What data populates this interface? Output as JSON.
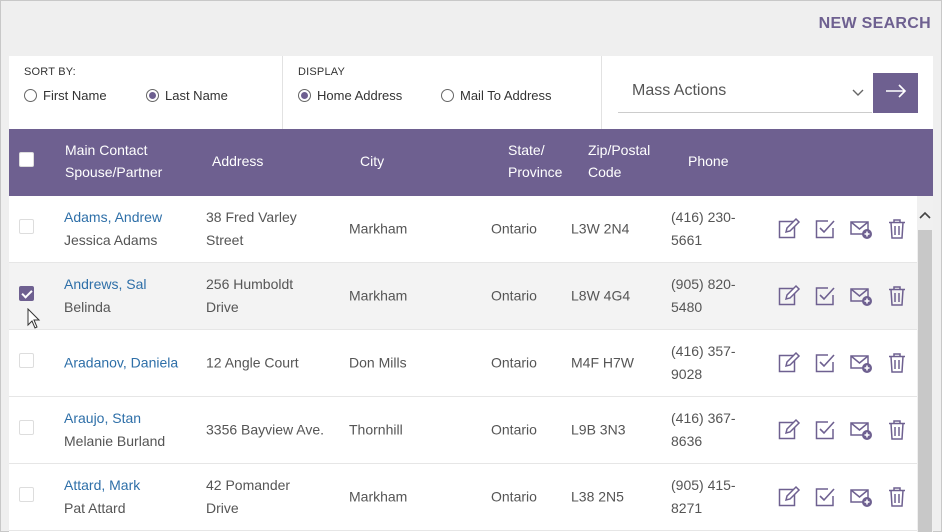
{
  "header": {
    "new_search": "NEW SEARCH"
  },
  "sort": {
    "label": "SORT BY:",
    "options": [
      {
        "label": "First Name",
        "selected": false
      },
      {
        "label": "Last Name",
        "selected": true
      }
    ]
  },
  "display": {
    "label": "DISPLAY",
    "options": [
      {
        "label": "Home Address",
        "selected": true
      },
      {
        "label": "Mail To Address",
        "selected": false
      }
    ]
  },
  "mass_actions": {
    "selected": "Mass Actions",
    "go_icon": "arrow-right-icon"
  },
  "table": {
    "headers": {
      "contact_line1": "Main Contact",
      "contact_line2": "Spouse/Partner",
      "address": "Address",
      "city": "City",
      "state_line1": "State/",
      "state_line2": "Province",
      "zip_line1": "Zip/Postal",
      "zip_line2": "Code",
      "phone": "Phone"
    },
    "rows": [
      {
        "name": "Adams, Andrew",
        "spouse": "Jessica Adams",
        "addr1": "38 Fred Varley",
        "addr2": "Street",
        "city": "Markham",
        "state": "Ontario",
        "zip": "L3W 2N4",
        "phone1": "(416) 230-",
        "phone2": "5661",
        "checked": false
      },
      {
        "name": "Andrews, Sal",
        "spouse": "Belinda",
        "addr1": "256 Humboldt",
        "addr2": "Drive",
        "city": "Markham",
        "state": "Ontario",
        "zip": "L8W 4G4",
        "phone1": "(905) 820-",
        "phone2": "5480",
        "checked": true
      },
      {
        "name": "Aradanov, Daniela",
        "spouse": "",
        "addr1": "12 Angle Court",
        "addr2": "",
        "city": "Don Mills",
        "state": "Ontario",
        "zip": "M4F H7W",
        "phone1": "(416) 357-",
        "phone2": "9028",
        "checked": false
      },
      {
        "name": "Araujo, Stan",
        "spouse": "Melanie Burland",
        "addr1": "3356 Bayview Ave.",
        "addr2": "",
        "city": "Thornhill",
        "state": "Ontario",
        "zip": "L9B 3N3",
        "phone1": "(416) 367-",
        "phone2": "8636",
        "checked": false
      },
      {
        "name": "Attard, Mark",
        "spouse": "Pat Attard",
        "addr1": "42 Pomander",
        "addr2": "Drive",
        "city": "Markham",
        "state": "Ontario",
        "zip": "L38 2N5",
        "phone1": "(905) 415-",
        "phone2": "8271",
        "checked": false
      }
    ],
    "row_actions": [
      "edit-icon",
      "task-check-icon",
      "email-add-icon",
      "trash-icon"
    ]
  },
  "colors": {
    "accent": "#6e6090",
    "link": "#2e6fa8"
  }
}
